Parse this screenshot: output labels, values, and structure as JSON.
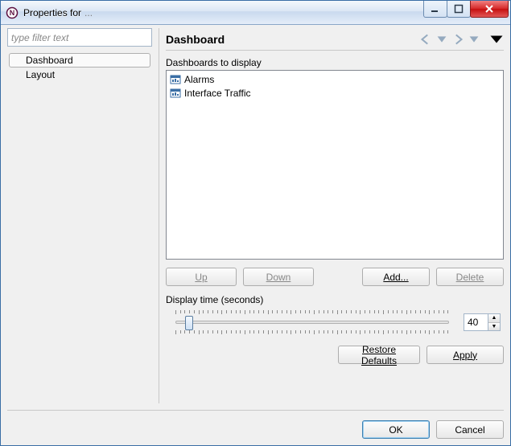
{
  "window": {
    "title": "Properties for",
    "faded_suffix": "..."
  },
  "left": {
    "filter_placeholder": "type filter text",
    "tree": {
      "items": [
        {
          "label": "Dashboard",
          "selected": true
        },
        {
          "label": "Layout",
          "selected": false
        }
      ]
    }
  },
  "page": {
    "title": "Dashboard",
    "dashboards_label": "Dashboards to display",
    "list": [
      "Alarms",
      "Interface Traffic"
    ],
    "buttons": {
      "up": "Up",
      "down": "Down",
      "add": "Add...",
      "delete": "Delete"
    },
    "display_time_label": "Display time (seconds)",
    "display_time_value": "40",
    "restore_defaults": "Restore Defaults",
    "apply": "Apply"
  },
  "footer": {
    "ok": "OK",
    "cancel": "Cancel"
  }
}
